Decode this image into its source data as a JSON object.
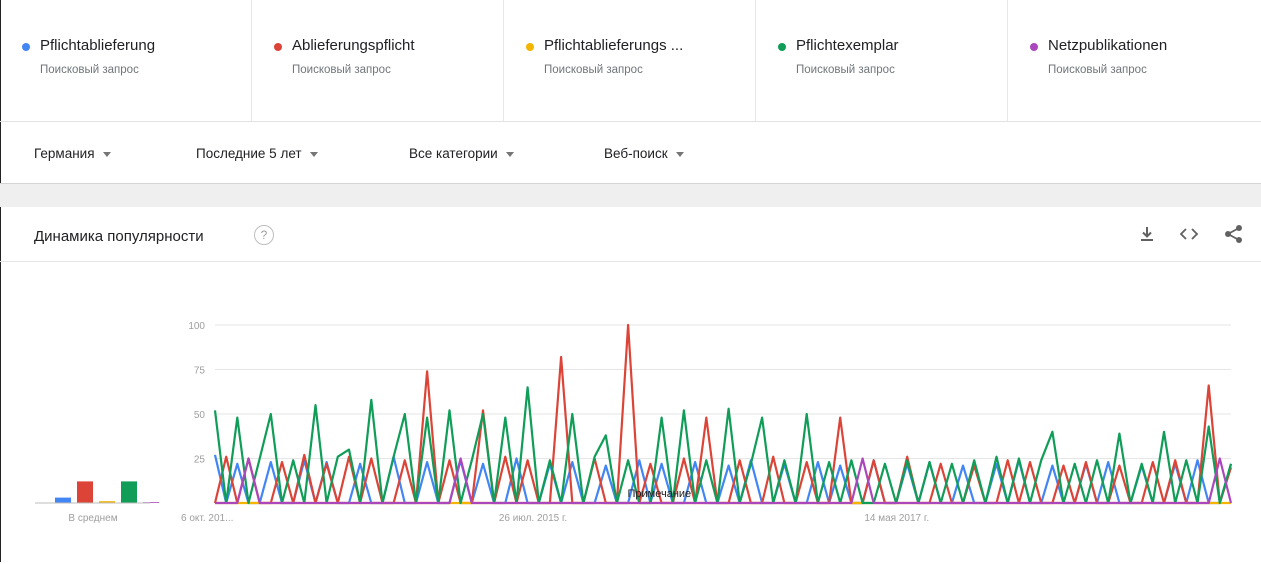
{
  "terms": [
    {
      "name": "Pflichtablieferung",
      "sub": "Поисковый запрос",
      "color": "#4285f4"
    },
    {
      "name": "Ablieferungspflicht",
      "sub": "Поисковый запрос",
      "color": "#db4437"
    },
    {
      "name": "Pflichtablieferungs ...",
      "sub": "Поисковый запрос",
      "color": "#f4b400"
    },
    {
      "name": "Pflichtexemplar",
      "sub": "Поисковый запрос",
      "color": "#0f9d58"
    },
    {
      "name": "Netzpublikationen",
      "sub": "Поисковый запрос",
      "color": "#ab47bc"
    }
  ],
  "filters": {
    "region": "Германия",
    "period": "Последние 5 лет",
    "category": "Все категории",
    "search_type": "Веб-поиск"
  },
  "card": {
    "title": "Динамика популярности",
    "help": "?"
  },
  "chart_data": {
    "type": "line",
    "title": "",
    "xlabel": "",
    "ylabel": "",
    "ylim": [
      0,
      100
    ],
    "yticks": [
      "25",
      "50",
      "75",
      "100"
    ],
    "x_tick_labels": [
      "6 окт. 201...",
      "26 июл. 2015 г.",
      "14 мая 2017 г."
    ],
    "x_tick_positions": [
      0,
      0.313,
      0.671
    ],
    "annotation": "Примечание",
    "annotation_position": 0.406,
    "grid": true,
    "averages": {
      "label": "В среднем",
      "values": [
        3,
        12,
        1,
        12,
        0
      ]
    },
    "series": [
      {
        "name": "Pflichtablieferung",
        "color": "#4285f4",
        "values": [
          27,
          0,
          22,
          0,
          0,
          23,
          0,
          0,
          24,
          0,
          23,
          0,
          0,
          22,
          0,
          0,
          26,
          0,
          0,
          23,
          0,
          0,
          24,
          0,
          22,
          0,
          0,
          25,
          0,
          0,
          22,
          0,
          23,
          0,
          0,
          21,
          0,
          0,
          24,
          0,
          22,
          0,
          0,
          23,
          0,
          0,
          21,
          0,
          24,
          0,
          0,
          22,
          0,
          0,
          23,
          0,
          21,
          0,
          0,
          24,
          0,
          0,
          22,
          0,
          23,
          0,
          0,
          21,
          0,
          0,
          22,
          0,
          24,
          0,
          0,
          21,
          0,
          0,
          22,
          0,
          23,
          0,
          0,
          21,
          0,
          0,
          22,
          0,
          24,
          0,
          0,
          22
        ]
      },
      {
        "name": "Ablieferungspflicht",
        "color": "#db4437",
        "values": [
          0,
          26,
          0,
          25,
          0,
          0,
          23,
          0,
          27,
          0,
          22,
          0,
          26,
          0,
          25,
          0,
          0,
          24,
          0,
          74,
          0,
          24,
          0,
          0,
          52,
          0,
          26,
          0,
          24,
          0,
          0,
          82,
          0,
          0,
          25,
          0,
          0,
          100,
          0,
          22,
          0,
          0,
          25,
          0,
          48,
          0,
          0,
          24,
          0,
          0,
          26,
          0,
          0,
          23,
          0,
          0,
          48,
          0,
          0,
          24,
          0,
          0,
          26,
          0,
          0,
          22,
          0,
          0,
          21,
          0,
          0,
          24,
          0,
          23,
          0,
          0,
          21,
          0,
          23,
          0,
          0,
          21,
          0,
          0,
          23,
          0,
          24,
          0,
          0,
          66,
          0,
          20
        ]
      },
      {
        "name": "Pflichtablieferungs ...",
        "color": "#f4b400",
        "values": [
          0,
          0,
          0,
          0,
          0,
          0,
          0,
          0,
          0,
          0,
          0,
          0,
          0,
          0,
          0,
          0,
          0,
          0,
          0,
          0,
          0,
          0,
          0,
          0,
          0,
          0,
          0,
          0,
          0,
          0,
          0,
          0,
          0,
          0,
          0,
          0,
          0,
          0,
          0,
          0,
          0,
          0,
          0,
          0,
          0,
          0,
          0,
          0,
          0,
          0,
          0,
          0,
          0,
          0,
          0,
          0,
          0,
          0,
          0,
          0,
          0,
          0,
          0,
          0,
          0,
          0,
          0,
          0,
          0,
          0,
          0,
          0,
          0,
          0,
          0,
          0,
          0,
          0,
          0,
          0,
          0,
          0,
          0,
          0,
          0,
          0,
          0,
          0,
          0,
          0,
          0,
          0
        ]
      },
      {
        "name": "Pflichtexemplar",
        "color": "#0f9d58",
        "values": [
          52,
          0,
          48,
          0,
          25,
          50,
          0,
          24,
          0,
          55,
          0,
          26,
          30,
          0,
          58,
          0,
          26,
          50,
          0,
          48,
          0,
          52,
          0,
          24,
          50,
          0,
          48,
          0,
          65,
          0,
          24,
          0,
          50,
          0,
          26,
          38,
          0,
          24,
          0,
          0,
          48,
          0,
          52,
          0,
          24,
          0,
          53,
          0,
          22,
          48,
          0,
          24,
          0,
          50,
          0,
          23,
          0,
          24,
          0,
          0,
          22,
          0,
          24,
          0,
          23,
          0,
          22,
          0,
          24,
          0,
          26,
          0,
          25,
          0,
          24,
          40,
          0,
          22,
          0,
          24,
          0,
          39,
          0,
          22,
          0,
          40,
          0,
          24,
          0,
          43,
          0,
          22
        ]
      },
      {
        "name": "Netzpublikationen",
        "color": "#ab47bc",
        "values": [
          0,
          0,
          0,
          25,
          0,
          0,
          0,
          0,
          0,
          0,
          0,
          0,
          0,
          0,
          0,
          0,
          0,
          0,
          0,
          0,
          0,
          0,
          25,
          0,
          0,
          0,
          0,
          0,
          0,
          0,
          0,
          0,
          0,
          0,
          0,
          0,
          0,
          0,
          0,
          0,
          0,
          0,
          0,
          0,
          0,
          0,
          0,
          0,
          0,
          0,
          0,
          0,
          0,
          0,
          0,
          0,
          0,
          0,
          25,
          0,
          0,
          0,
          0,
          0,
          0,
          0,
          0,
          0,
          0,
          0,
          0,
          0,
          0,
          0,
          0,
          0,
          0,
          0,
          0,
          0,
          0,
          0,
          0,
          0,
          0,
          0,
          0,
          0,
          0,
          0,
          25,
          0
        ]
      }
    ]
  }
}
